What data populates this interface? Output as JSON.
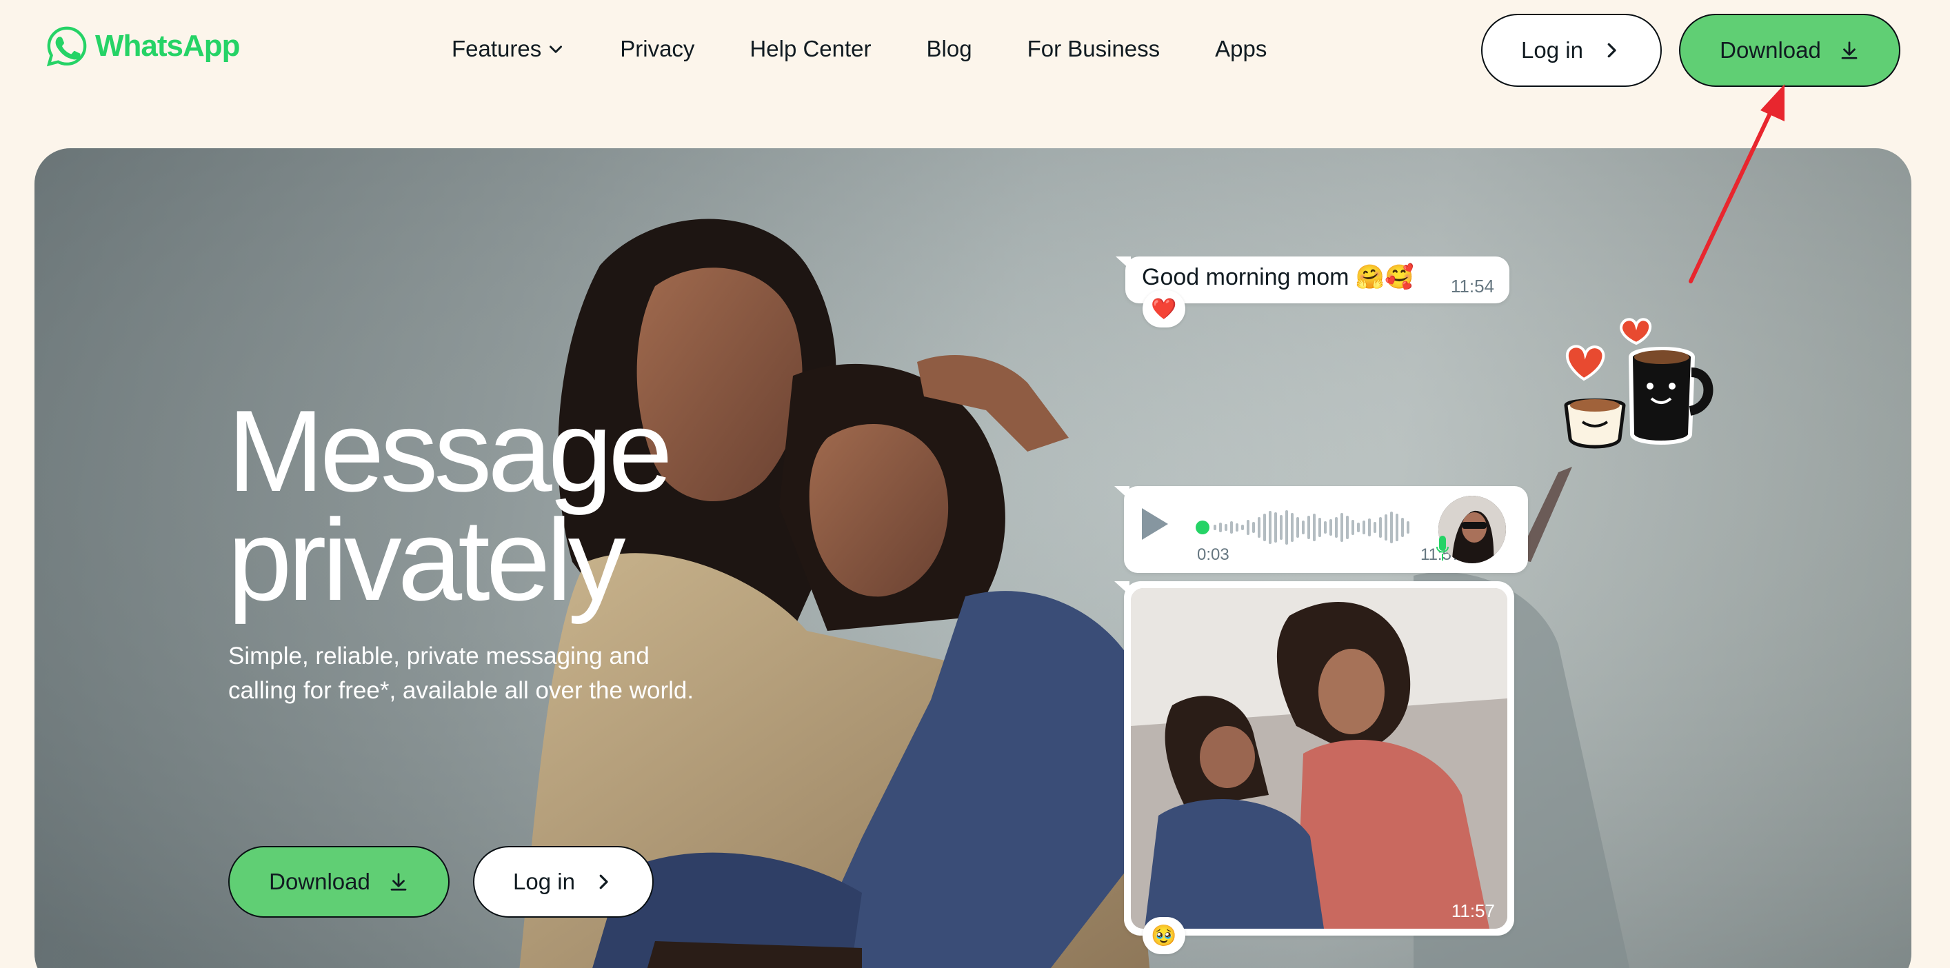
{
  "brand": {
    "name": "WhatsApp",
    "color": "#25d366"
  },
  "nav": {
    "links": [
      {
        "label": "Features",
        "has_dropdown": true
      },
      {
        "label": "Privacy"
      },
      {
        "label": "Help Center"
      },
      {
        "label": "Blog"
      },
      {
        "label": "For Business"
      },
      {
        "label": "Apps"
      }
    ],
    "login_label": "Log in",
    "download_label": "Download"
  },
  "hero": {
    "headline_line1": "Message",
    "headline_line2": "privately",
    "subline": "Simple, reliable, private messaging and calling for free*, available all over the world.",
    "download_label": "Download",
    "login_label": "Log in"
  },
  "chat": {
    "message1": {
      "text": "Good morning mom 🤗🥰",
      "time": "11:54",
      "reaction": "❤️"
    },
    "voice": {
      "elapsed": "0:03",
      "time": "11:57",
      "progress": 0.02
    },
    "photo": {
      "time": "11:57",
      "reaction": "🥹"
    }
  },
  "colors": {
    "accent_green": "#60cf74",
    "page_bg": "#fcf5eb",
    "annotation_red": "#e8262e"
  },
  "icons": [
    "whatsapp-logo-icon",
    "chevron-down-icon",
    "chevron-right-icon",
    "download-icon",
    "play-icon",
    "mic-icon",
    "coffee-sticker"
  ]
}
